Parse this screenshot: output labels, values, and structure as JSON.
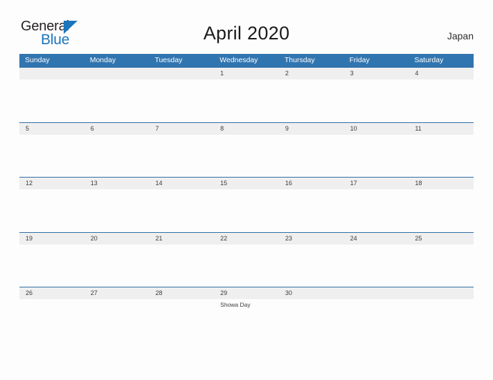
{
  "brand": {
    "name_part1": "General",
    "name_part2": "Blue",
    "triangle_icon": "triangle-icon",
    "colors": {
      "dark": "#231f20",
      "blue": "#1a75bc"
    }
  },
  "header": {
    "title": "April 2020",
    "country": "Japan"
  },
  "calendar": {
    "colors": {
      "header_bar": "#3175b0",
      "row_divider": "#2e6da4",
      "date_band": "#efefef",
      "page_background": "#fdfdfd"
    },
    "weekdays": [
      "Sunday",
      "Monday",
      "Tuesday",
      "Wednesday",
      "Thursday",
      "Friday",
      "Saturday"
    ],
    "weeks": [
      [
        {
          "day": "",
          "events": []
        },
        {
          "day": "",
          "events": []
        },
        {
          "day": "",
          "events": []
        },
        {
          "day": "1",
          "events": []
        },
        {
          "day": "2",
          "events": []
        },
        {
          "day": "3",
          "events": []
        },
        {
          "day": "4",
          "events": []
        }
      ],
      [
        {
          "day": "5",
          "events": []
        },
        {
          "day": "6",
          "events": []
        },
        {
          "day": "7",
          "events": []
        },
        {
          "day": "8",
          "events": []
        },
        {
          "day": "9",
          "events": []
        },
        {
          "day": "10",
          "events": []
        },
        {
          "day": "11",
          "events": []
        }
      ],
      [
        {
          "day": "12",
          "events": []
        },
        {
          "day": "13",
          "events": []
        },
        {
          "day": "14",
          "events": []
        },
        {
          "day": "15",
          "events": []
        },
        {
          "day": "16",
          "events": []
        },
        {
          "day": "17",
          "events": []
        },
        {
          "day": "18",
          "events": []
        }
      ],
      [
        {
          "day": "19",
          "events": []
        },
        {
          "day": "20",
          "events": []
        },
        {
          "day": "21",
          "events": []
        },
        {
          "day": "22",
          "events": []
        },
        {
          "day": "23",
          "events": []
        },
        {
          "day": "24",
          "events": []
        },
        {
          "day": "25",
          "events": []
        }
      ],
      [
        {
          "day": "26",
          "events": []
        },
        {
          "day": "27",
          "events": []
        },
        {
          "day": "28",
          "events": []
        },
        {
          "day": "29",
          "events": [
            "Showa Day"
          ]
        },
        {
          "day": "30",
          "events": []
        },
        {
          "day": "",
          "events": []
        },
        {
          "day": "",
          "events": []
        }
      ]
    ]
  }
}
